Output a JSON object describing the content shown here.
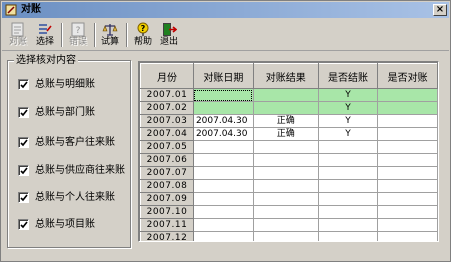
{
  "window": {
    "title": "对账"
  },
  "toolbar": {
    "buttons": [
      {
        "label": "对账",
        "icon": "reconcile-icon",
        "enabled": false
      },
      {
        "label": "选择",
        "icon": "select-icon",
        "enabled": true
      },
      {
        "label": "错误",
        "icon": "error-icon",
        "enabled": false
      },
      {
        "label": "试算",
        "icon": "balance-scale-icon",
        "enabled": true
      },
      {
        "label": "帮助",
        "icon": "help-icon",
        "enabled": true
      },
      {
        "label": "退出",
        "icon": "exit-icon",
        "enabled": true
      }
    ]
  },
  "options": {
    "title": "选择核对内容",
    "items": [
      {
        "label": "总账与明细账",
        "checked": true
      },
      {
        "label": "总账与部门账",
        "checked": true
      },
      {
        "label": "总账与客户往来账",
        "checked": true
      },
      {
        "label": "总账与供应商往来账",
        "checked": true
      },
      {
        "label": "总账与个人往来账",
        "checked": true
      },
      {
        "label": "总账与项目账",
        "checked": true
      }
    ]
  },
  "grid": {
    "columns": [
      "月份",
      "对账日期",
      "对账结果",
      "是否结账",
      "是否对账"
    ],
    "rows": [
      {
        "month": "2007.01",
        "date": "",
        "result": "",
        "closed": "Y",
        "reconciled": "",
        "highlight": true
      },
      {
        "month": "2007.02",
        "date": "",
        "result": "",
        "closed": "Y",
        "reconciled": "",
        "highlight": true
      },
      {
        "month": "2007.03",
        "date": "2007.04.30",
        "result": "正确",
        "closed": "Y",
        "reconciled": "",
        "highlight": false
      },
      {
        "month": "2007.04",
        "date": "2007.04.30",
        "result": "正确",
        "closed": "Y",
        "reconciled": "",
        "highlight": false
      },
      {
        "month": "2007.05",
        "date": "",
        "result": "",
        "closed": "",
        "reconciled": "",
        "highlight": false
      },
      {
        "month": "2007.06",
        "date": "",
        "result": "",
        "closed": "",
        "reconciled": "",
        "highlight": false
      },
      {
        "month": "2007.07",
        "date": "",
        "result": "",
        "closed": "",
        "reconciled": "",
        "highlight": false
      },
      {
        "month": "2007.08",
        "date": "",
        "result": "",
        "closed": "",
        "reconciled": "",
        "highlight": false
      },
      {
        "month": "2007.09",
        "date": "",
        "result": "",
        "closed": "",
        "reconciled": "",
        "highlight": false
      },
      {
        "month": "2007.10",
        "date": "",
        "result": "",
        "closed": "",
        "reconciled": "",
        "highlight": false
      },
      {
        "month": "2007.11",
        "date": "",
        "result": "",
        "closed": "",
        "reconciled": "",
        "highlight": false
      },
      {
        "month": "2007.12",
        "date": "",
        "result": "",
        "closed": "",
        "reconciled": "",
        "highlight": false
      }
    ]
  },
  "colors": {
    "highlight_row": "#a8e6a8",
    "titlebar_start": "#6b8fc2",
    "titlebar_end": "#a9c2e6",
    "face": "#d4d0c8"
  }
}
